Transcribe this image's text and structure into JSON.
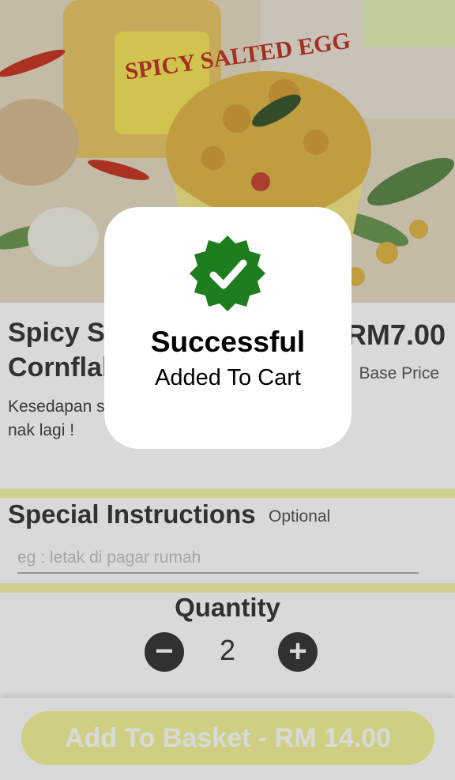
{
  "product": {
    "name": "Spicy Salted Egg Cornflakes",
    "price": "RM7.00",
    "price_caption": "Base Price",
    "description": "Kesedapan sedap oleh aducktive nak lagi !",
    "image_label": "SPICY SALTED EGG"
  },
  "instructions": {
    "title": "Special Instructions",
    "optional_label": "Optional",
    "placeholder": "eg : letak di pagar rumah",
    "value": ""
  },
  "quantity": {
    "title": "Quantity",
    "value": "2",
    "minus_symbol": "−",
    "plus_symbol": "+"
  },
  "footer": {
    "button_label": "Add To Basket - RM 14.00"
  },
  "modal": {
    "title": "Successful",
    "message": "Added To Cart",
    "badge_color": "#1e7d1e"
  },
  "colors": {
    "accent": "#f4f49a",
    "divider": "#f4f4a8",
    "text_dark": "#3a3a3a"
  }
}
